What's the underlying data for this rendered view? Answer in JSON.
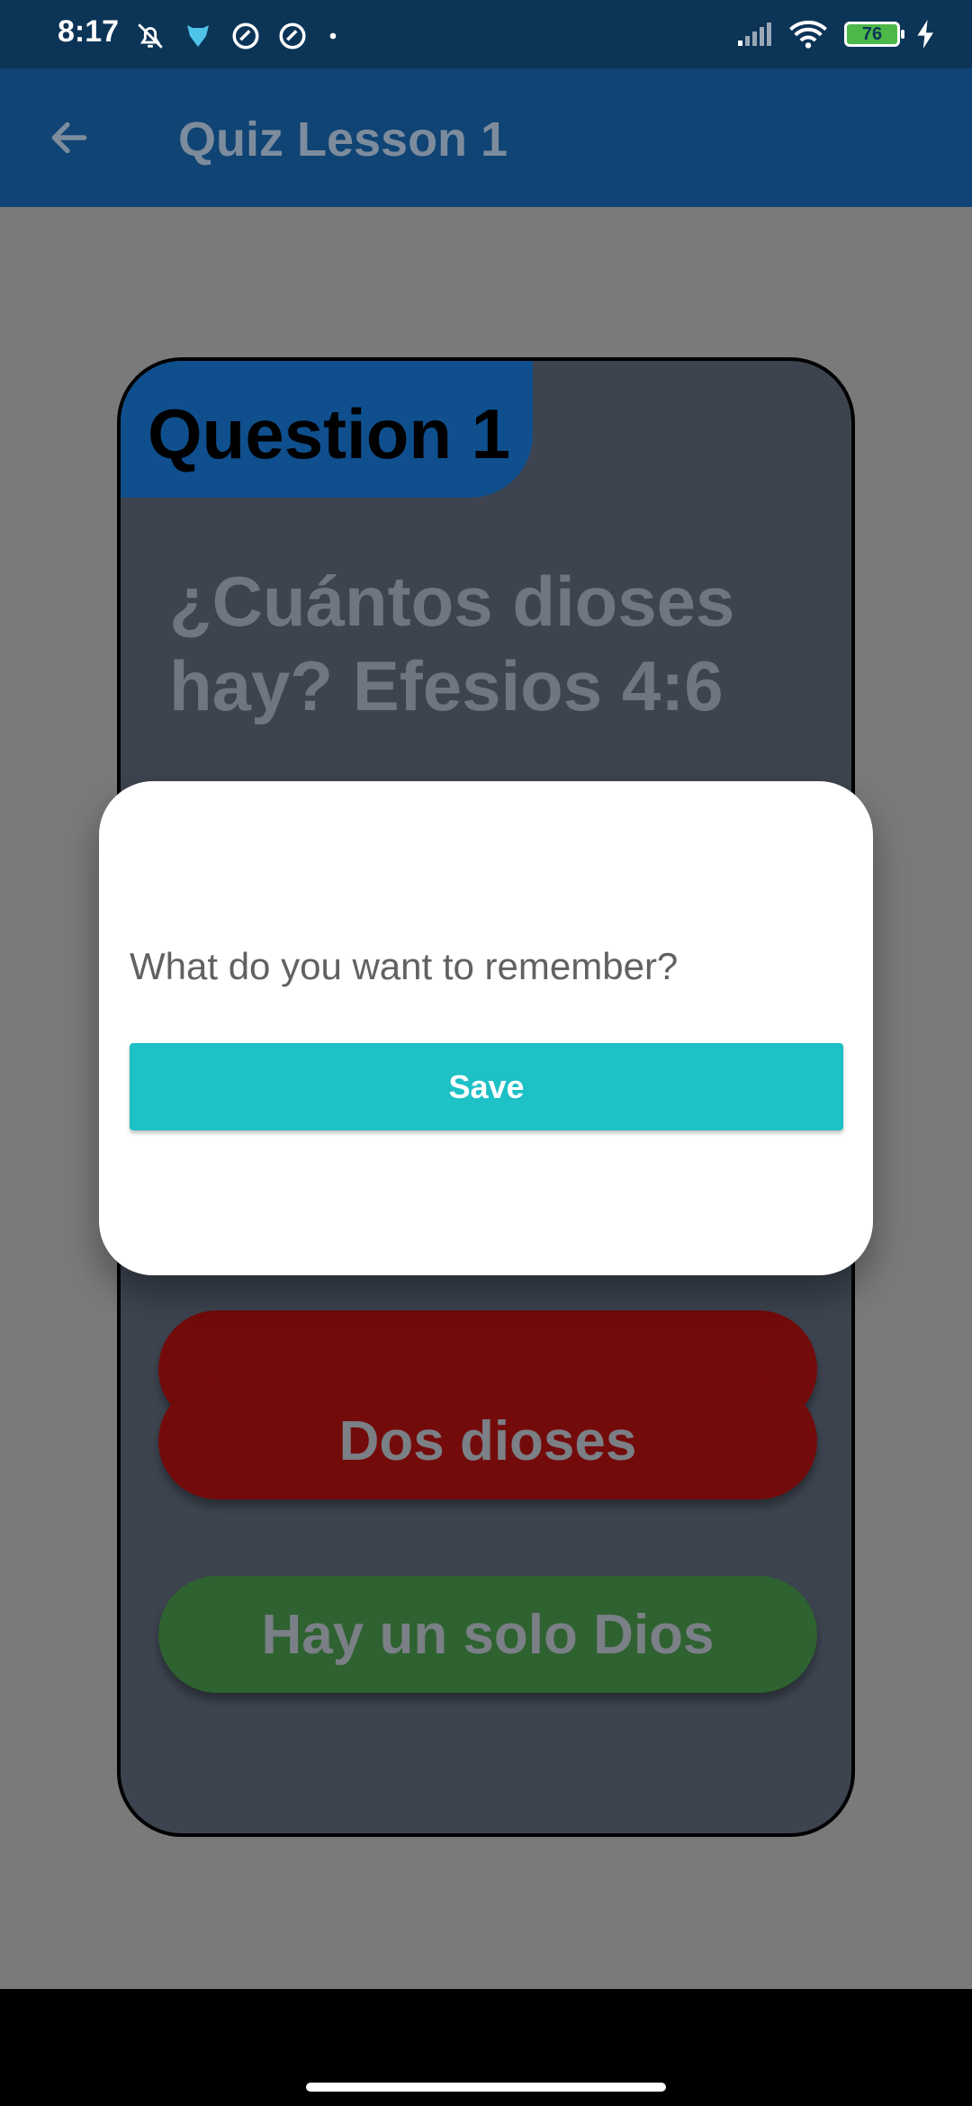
{
  "status_bar": {
    "time": "8:17",
    "battery": "76",
    "icons": [
      "bell-off-icon",
      "app-logo-icon",
      "at-icon",
      "at-icon",
      "dot-icon",
      "signal-icon",
      "wifi-icon",
      "battery-icon",
      "charging-icon"
    ]
  },
  "app_bar": {
    "title": "Quiz Lesson 1",
    "back_icon": "arrow-left-icon"
  },
  "quiz": {
    "question_label": "Question 1",
    "question_text": "¿Cuántos dioses hay? Efesios 4:6",
    "answers": [
      {
        "label": "Dos dioses",
        "color": "#740b0b"
      },
      {
        "label": "Hay un solo Dios",
        "color": "#2e6230"
      }
    ]
  },
  "dialog": {
    "prompt": "What do you want to remember?",
    "save_label": "Save",
    "save_color": "#1dc1c6"
  }
}
